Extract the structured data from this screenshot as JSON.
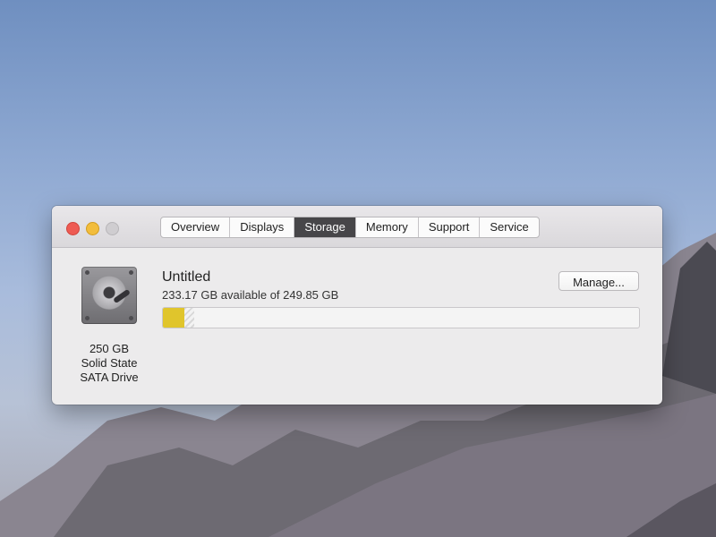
{
  "tabs": [
    {
      "label": "Overview"
    },
    {
      "label": "Displays"
    },
    {
      "label": "Storage"
    },
    {
      "label": "Memory"
    },
    {
      "label": "Support"
    },
    {
      "label": "Service"
    }
  ],
  "active_tab": "Storage",
  "drive": {
    "capacity": "250 GB",
    "type_line1": "Solid State",
    "type_line2": "SATA Drive",
    "icon": "hard-drive-icon"
  },
  "volume": {
    "name": "Untitled",
    "availability": "233.17 GB available of 249.85 GB",
    "used_fraction": 0.045,
    "purgeable_fraction": 0.02
  },
  "manage_label": "Manage...",
  "colors": {
    "used_segment": "#e0c52c",
    "active_tab": "#474649",
    "close": "#ee5b53",
    "minimize": "#f2bd3c"
  }
}
